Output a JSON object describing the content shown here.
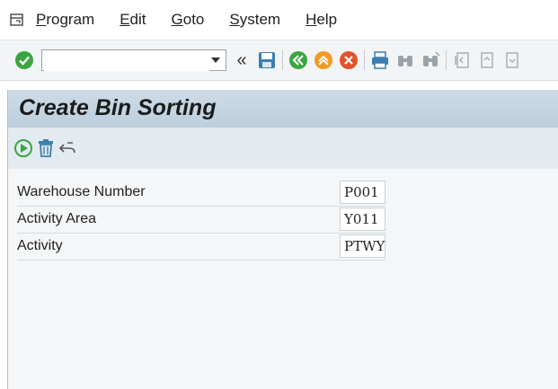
{
  "menubar": {
    "items": [
      "Program",
      "Edit",
      "Goto",
      "System",
      "Help"
    ]
  },
  "toolbar": {
    "command_field_value": "",
    "icons": [
      "enter-check-icon",
      "command-dropdown-icon",
      "collapse-icon",
      "save-icon",
      "back-icon",
      "exit-icon",
      "cancel-icon",
      "print-icon",
      "find-icon",
      "find-next-icon",
      "first-page-icon",
      "previous-page-icon",
      "next-page-icon"
    ]
  },
  "screen": {
    "title": "Create Bin Sorting"
  },
  "app_toolbar": {
    "icons": [
      "execute-icon",
      "delete-icon",
      "undo-icon"
    ]
  },
  "fields": [
    {
      "label": "Warehouse Number",
      "value": "P001"
    },
    {
      "label": "Activity Area",
      "value": "Y011"
    },
    {
      "label": "Activity",
      "value": "PTWY"
    }
  ],
  "colors": {
    "title_bar": "#c5d6e3",
    "toolbar_bg": "#f2f4f5",
    "enter_green": "#3aa641",
    "back_green": "#3aa641",
    "exit_orange": "#f29a1f",
    "cancel_orange": "#e0542b",
    "save_blue": "#3b7fae"
  }
}
